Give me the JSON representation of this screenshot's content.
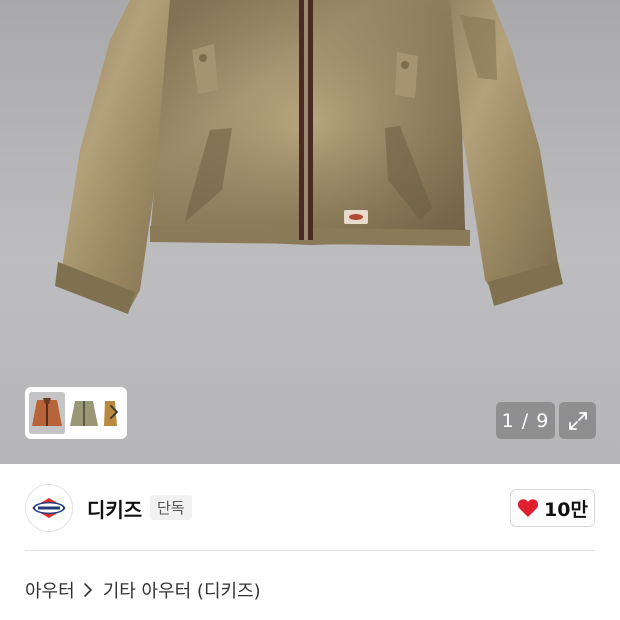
{
  "gallery": {
    "counter": "1 / 9",
    "thumbnails": [
      {
        "name": "orange-jacket-thumb",
        "color": "#b8643a"
      },
      {
        "name": "olive-jacket-thumb",
        "color": "#9a9777"
      },
      {
        "name": "tan-jacket-thumb",
        "color": "#b8893f"
      }
    ]
  },
  "brand": {
    "name": "디키즈",
    "badge": "단독",
    "likes": "10만"
  },
  "breadcrumb": {
    "level1": "아우터",
    "level2": "기타 아우터 (디키즈)"
  },
  "colors": {
    "heart": "#e0202f",
    "jacket": "#9a8862",
    "zipper": "#4a2a24"
  }
}
